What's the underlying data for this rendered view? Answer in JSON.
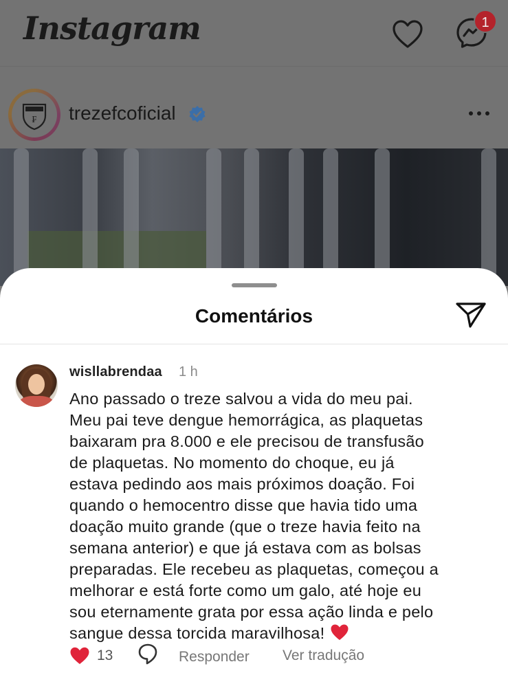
{
  "app": {
    "logo": "Instagram",
    "notification_count": "1"
  },
  "post": {
    "username": "trezefcoficial"
  },
  "sheet": {
    "title": "Comentários"
  },
  "comment": {
    "username": "wisllabrendaa",
    "time": "1 h",
    "lines": [
      "Ano passado o treze salvou a vida do meu pai.",
      "Meu pai teve dengue hemorrágica, as plaquetas",
      "baixaram pra 8.000 e ele precisou de transfusão",
      "de plaquetas. No momento do choque, eu já",
      "estava pedindo aos mais próximos doação. Foi",
      "quando o hemocentro disse que havia tido uma",
      "doação muito grande (que o treze havia feito na",
      "semana anterior) e que já estava com as bolsas",
      "preparadas. Ele recebeu as plaquetas, começou a",
      "melhorar e está forte como um galo, até hoje eu",
      "sou eternamente grata por essa ação linda e pelo",
      "sangue dessa torcida maravilhosa!"
    ],
    "like_count": "13",
    "reply_label": "Responder",
    "translate_label": "Ver tradução"
  },
  "colors": {
    "like_red": "#e0243a",
    "badge_red": "#b4232b",
    "verified_blue": "#3b82d6"
  }
}
